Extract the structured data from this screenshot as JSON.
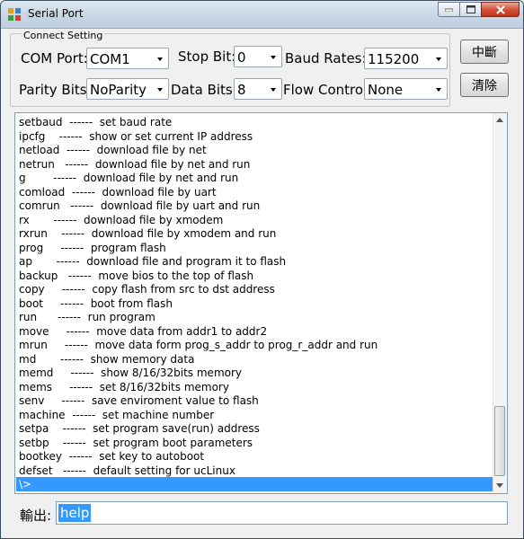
{
  "window": {
    "title": "Serial Port"
  },
  "group": {
    "label": "Connect Setting"
  },
  "settings": {
    "com_port_label": "COM Port:",
    "com_port_value": "COM1",
    "stop_bit_label": "Stop Bit:",
    "stop_bit_value": "0",
    "baud_label": "Baud Rates:",
    "baud_value": "115200",
    "parity_label": "Parity Bits:",
    "parity_value": "NoParity",
    "data_bits_label": "Data Bits:",
    "data_bits_value": "8",
    "flow_label": "Flow Control:",
    "flow_value": "None"
  },
  "buttons": {
    "disconnect": "中斷",
    "clear": "清除"
  },
  "console": {
    "lines": [
      "setbaud  ------  set baud rate",
      "ipcfg    ------  show or set current IP address",
      "netload  ------  download file by net",
      "netrun   ------  download file by net and run",
      "g        ------  download file by net and run",
      "comload  ------  download file by uart",
      "comrun   ------  download file by uart and run",
      "rx       ------  download file by xmodem",
      "rxrun    ------  download file by xmodem and run",
      "prog     ------  program flash",
      "ap       ------  download file and program it to flash",
      "backup   ------  move bios to the top of flash",
      "copy     ------  copy flash from src to dst address",
      "boot     ------  boot from flash",
      "run      ------  run program",
      "move     ------  move data from addr1 to addr2",
      "mrun     ------  move data form prog_s_addr to prog_r_addr and run",
      "md       ------  show memory data",
      "memd     ------  show 8/16/32bits memory",
      "mems     ------  set 8/16/32bits memory",
      "senv     ------  save enviroment value to flash",
      "machine  ------  set machine number",
      "setpa    ------  set program save(run) address",
      "setbp    ------  set program boot parameters",
      "bootkey  ------  set key to autoboot",
      "defset   ------  default setting for ucLinux"
    ],
    "prompt": "\\>"
  },
  "output": {
    "label": "輸出:",
    "value": "help"
  }
}
